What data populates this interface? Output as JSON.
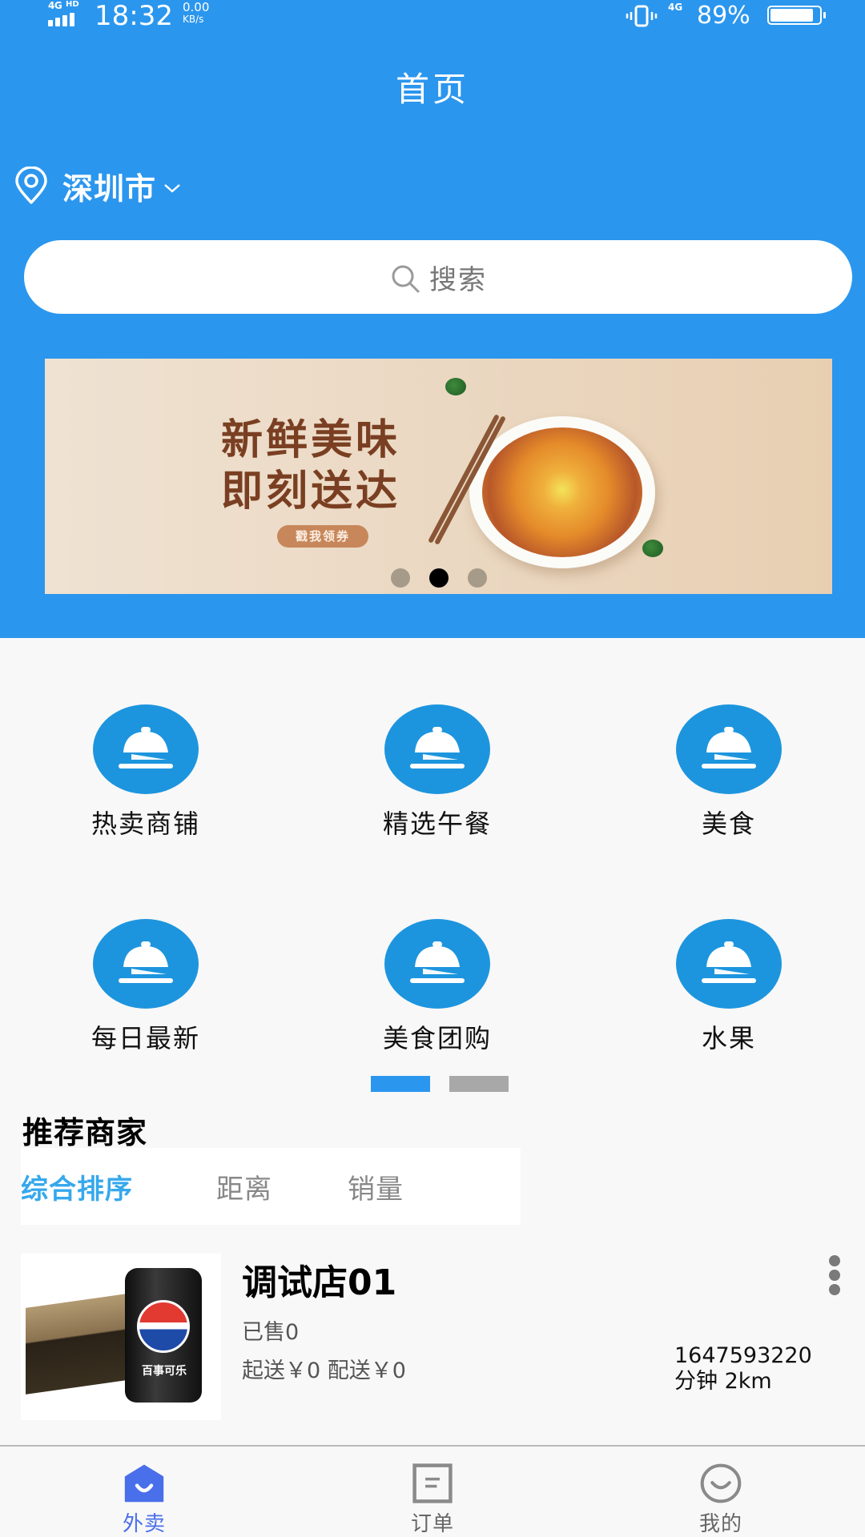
{
  "status_bar": {
    "network_type": "4G",
    "network_hd": "HD",
    "time": "18:32",
    "speed_value": "0.00",
    "speed_unit": "KB/s",
    "network_type_2": "4G",
    "battery_percent_label": "89%",
    "battery_level": 0.89
  },
  "header": {
    "title": "首页",
    "location": "深圳市",
    "search_placeholder": "搜索"
  },
  "banner": {
    "headline_line1": "新鲜美味",
    "headline_line2": "即刻送达",
    "coupon_label": "戳我领券",
    "slide_count": 3,
    "active_slide": 2
  },
  "categories": [
    {
      "label": "热卖商铺",
      "icon": "food-cloche-icon"
    },
    {
      "label": "精选午餐",
      "icon": "food-cloche-icon"
    },
    {
      "label": "美食",
      "icon": "food-cloche-icon"
    },
    {
      "label": "每日最新",
      "icon": "food-cloche-icon"
    },
    {
      "label": "美食团购",
      "icon": "food-cloche-icon"
    },
    {
      "label": "水果",
      "icon": "food-cloche-icon"
    }
  ],
  "category_pager": {
    "page_count": 2,
    "active_page": 1
  },
  "recommend": {
    "title": "推荐商家",
    "sort_tabs": [
      {
        "label": "综合排序",
        "active": true
      },
      {
        "label": "距离",
        "active": false
      },
      {
        "label": "销量",
        "active": false
      }
    ],
    "stores": [
      {
        "name": "调试店01",
        "sold": "已售0",
        "fees": "起送￥0 配送￥0",
        "eta_line1": "1647593220",
        "eta_line2": "分钟 2km",
        "image_text": "百事可乐"
      }
    ]
  },
  "tabbar": {
    "items": [
      {
        "label": "外卖",
        "icon": "home-smile-icon",
        "active": true
      },
      {
        "label": "订单",
        "icon": "order-list-icon",
        "active": false
      },
      {
        "label": "我的",
        "icon": "smile-profile-icon",
        "active": false
      }
    ]
  },
  "colors": {
    "header_blue": "#2b96ee",
    "category_blue": "#1d95de",
    "active_sort": "#36a8ec",
    "tab_active": "#4a6fea",
    "banner_text": "#7a3f22"
  }
}
